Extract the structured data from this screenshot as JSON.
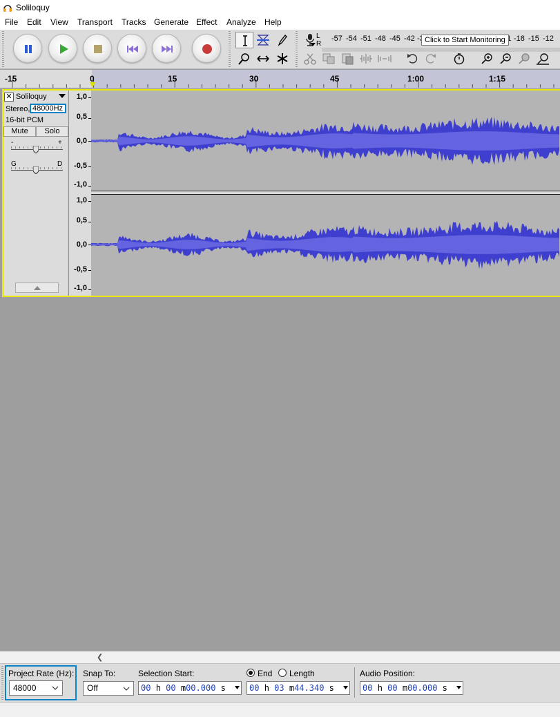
{
  "window": {
    "title": "Soliloquy"
  },
  "menu": [
    "File",
    "Edit",
    "View",
    "Transport",
    "Tracks",
    "Generate",
    "Effect",
    "Analyze",
    "Help"
  ],
  "meter": {
    "channels_label": [
      "L",
      "R"
    ],
    "ticks": [
      "-57",
      "-54",
      "-51",
      "-48",
      "-45",
      "-42",
      "-3",
      "21",
      "-18",
      "-15",
      "-12"
    ],
    "tooltip": "Click to Start Monitoring"
  },
  "timeline": {
    "ticks": [
      "-15",
      "0",
      "15",
      "30",
      "45",
      "1:00",
      "1:15"
    ]
  },
  "track": {
    "name": "Soliloquy",
    "channels": "Stereo,",
    "rate": "48000Hz",
    "format": "16-bit PCM",
    "mute": "Mute",
    "solo": "Solo",
    "gain_minus": "-",
    "gain_plus": "+",
    "pan_left": "G",
    "pan_right": "D",
    "scale_top": [
      "1,0",
      "0,5",
      "0,0",
      "-0,5",
      "-1,0"
    ],
    "scale_bottom": [
      "1,0",
      "0,5",
      "0,0",
      "-0,5",
      "-1,0"
    ],
    "waveform_color": "#3f3fcf",
    "waveform_rms_color": "#6464e0"
  },
  "selection_toolbar": {
    "project_rate_label": "Project Rate (Hz):",
    "project_rate_value": "48000",
    "snap_label": "Snap To:",
    "snap_value": "Off",
    "selection_start_label": "Selection Start:",
    "selection_start": {
      "h": "00",
      "m": "00",
      "s": "00.000"
    },
    "end_label": "End",
    "length_label": "Length",
    "end_value": {
      "h": "00",
      "m": "03",
      "s": "44.340"
    },
    "audio_position_label": "Audio Position:",
    "audio_position": {
      "h": "00",
      "m": "00",
      "s": "00.000"
    },
    "units": {
      "h": "h",
      "m": "m",
      "s": "s"
    }
  },
  "colors": {
    "highlight": "#0a84c6",
    "track_border": "#e8e800",
    "digits": "#1f3fb8"
  }
}
